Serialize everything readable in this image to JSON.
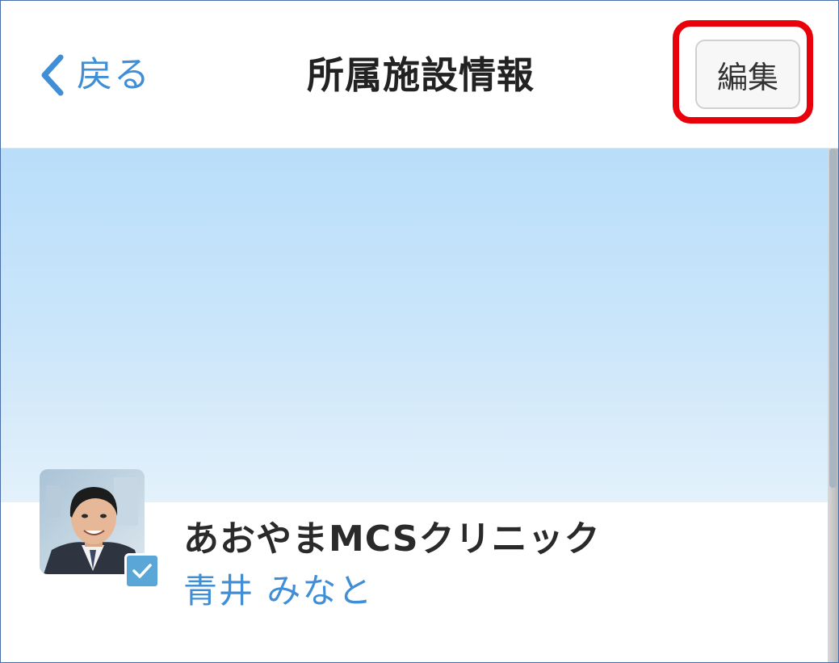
{
  "header": {
    "back_label": "戻る",
    "title": "所属施設情報",
    "edit_label": "編集",
    "back_icon": "chevron-left-icon"
  },
  "profile": {
    "clinic_name": "あおやまMCSクリニック",
    "user_name": "青井 みなと",
    "badge_icon": "check-icon"
  },
  "colors": {
    "accent": "#3f8ed6",
    "highlight": "#e8000b",
    "cover_top": "#b9defa",
    "cover_bottom": "#e3f1fb",
    "badge": "#5aa6d6"
  }
}
